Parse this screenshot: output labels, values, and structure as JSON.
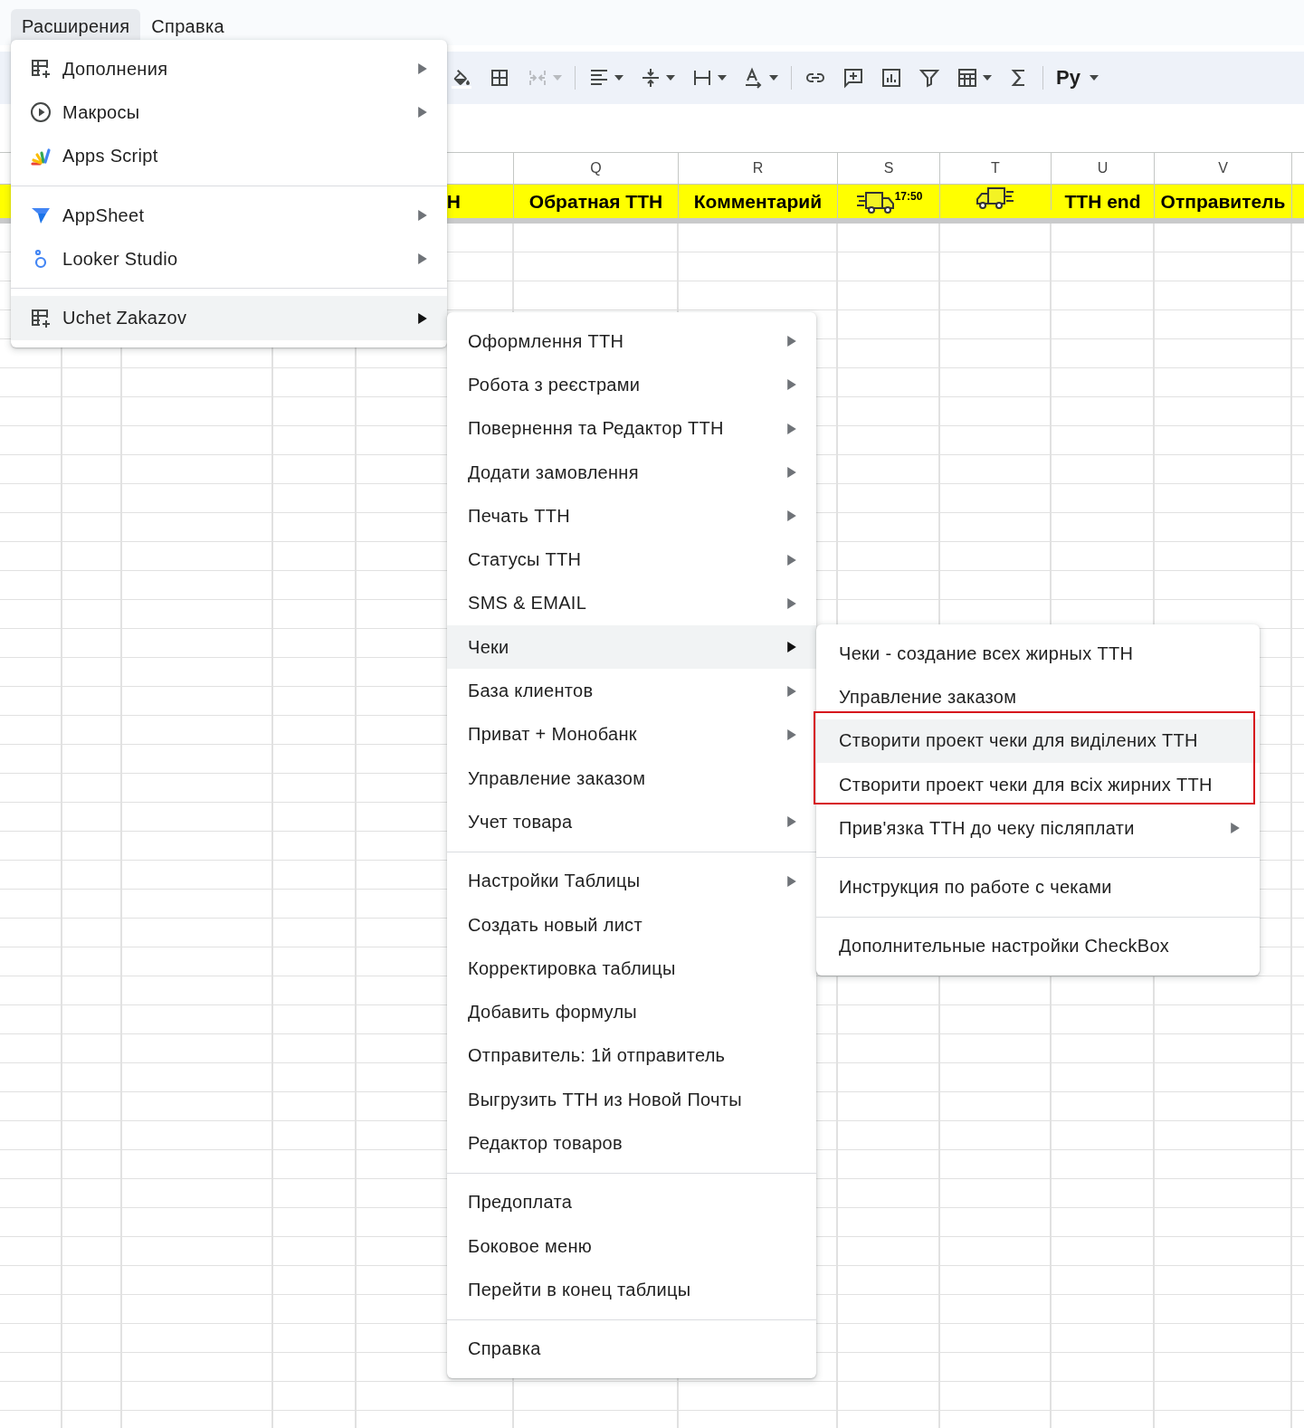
{
  "menubar": [
    {
      "label": "Расширения",
      "selected": true
    },
    {
      "label": "Справка",
      "selected": false
    }
  ],
  "toolbar": {
    "buttons": [
      {
        "disabled": false,
        "dropdown": false
      },
      {
        "disabled": false,
        "dropdown": false
      },
      {
        "disabled": true,
        "dropdown": true
      },
      {
        "disabled": false,
        "dropdown": true
      },
      {
        "disabled": false,
        "dropdown": true
      },
      {
        "disabled": false,
        "dropdown": true
      },
      {
        "disabled": false,
        "dropdown": true
      },
      {
        "disabled": false,
        "dropdown": false
      },
      {
        "disabled": false,
        "dropdown": false
      },
      {
        "disabled": false,
        "dropdown": false
      },
      {
        "disabled": false,
        "dropdown": false
      },
      {
        "disabled": false,
        "dropdown": true
      },
      {
        "disabled": false,
        "dropdown": false
      }
    ],
    "input_tools": "Ру"
  },
  "sheet": {
    "columns": [
      {
        "kind": "clipped",
        "header": "Н"
      },
      {
        "kind": "text",
        "letter": "Q",
        "header": "Обратная ТТН"
      },
      {
        "kind": "text",
        "letter": "R",
        "header": "Комментарий"
      },
      {
        "kind": "truck-time",
        "letter": "S",
        "header": "17:50"
      },
      {
        "kind": "truck",
        "letter": "T"
      },
      {
        "kind": "text",
        "letter": "U",
        "header": "ТТН end"
      },
      {
        "kind": "text",
        "letter": "V",
        "header": "Отправитель"
      }
    ]
  },
  "extensions_menu": {
    "groups": [
      {
        "items": [
          {
            "label": "Дополнения",
            "submenu": true,
            "selected": false
          },
          {
            "label": "Макросы",
            "submenu": true,
            "selected": false
          },
          {
            "label": "Apps Script",
            "submenu": false,
            "selected": false
          }
        ]
      },
      {
        "items": [
          {
            "label": "AppSheet",
            "submenu": true,
            "selected": false
          },
          {
            "label": "Looker Studio",
            "submenu": true,
            "selected": false
          }
        ]
      },
      {
        "items": [
          {
            "label": "Uchet Zakazov",
            "submenu": true,
            "selected": true
          }
        ]
      }
    ]
  },
  "uchet_menu": {
    "groups": [
      {
        "items": [
          {
            "label": "Оформлення ТТН",
            "submenu": true,
            "selected": false
          },
          {
            "label": "Робота з реєстрами",
            "submenu": true,
            "selected": false
          },
          {
            "label": "Повернення та Редактор ТТН",
            "submenu": true,
            "selected": false
          },
          {
            "label": "Додати замовлення",
            "submenu": true,
            "selected": false
          },
          {
            "label": "Печать ТТН",
            "submenu": true,
            "selected": false
          },
          {
            "label": "Статусы ТТН",
            "submenu": true,
            "selected": false
          },
          {
            "label": "SMS & EMAIL",
            "submenu": true,
            "selected": false
          },
          {
            "label": "Чеки",
            "submenu": true,
            "selected": true
          },
          {
            "label": "База клиентов",
            "submenu": true,
            "selected": false
          },
          {
            "label": "Приват + Монобанк",
            "submenu": true,
            "selected": false
          },
          {
            "label": "Управление заказом",
            "submenu": false,
            "selected": false
          },
          {
            "label": "Учет товара",
            "submenu": true,
            "selected": false
          }
        ]
      },
      {
        "items": [
          {
            "label": "Настройки Таблицы",
            "submenu": true,
            "selected": false
          },
          {
            "label": "Создать новый лист",
            "submenu": false,
            "selected": false
          },
          {
            "label": "Корректировка таблицы",
            "submenu": false,
            "selected": false
          },
          {
            "label": "Добавить формулы",
            "submenu": false,
            "selected": false
          },
          {
            "label": "Отправитель: 1й отправитель",
            "submenu": false,
            "selected": false
          },
          {
            "label": "Выгрузить ТТН из Новой Почты",
            "submenu": false,
            "selected": false
          },
          {
            "label": "Редактор товаров",
            "submenu": false,
            "selected": false
          }
        ]
      },
      {
        "items": [
          {
            "label": "Предоплата",
            "submenu": false,
            "selected": false
          },
          {
            "label": "Боковое меню",
            "submenu": false,
            "selected": false
          },
          {
            "label": "Перейти в конец таблицы",
            "submenu": false,
            "selected": false
          }
        ]
      },
      {
        "items": [
          {
            "label": "Справка",
            "submenu": false,
            "selected": false
          }
        ]
      }
    ]
  },
  "receipts_menu": {
    "groups": [
      {
        "items": [
          {
            "label": "Чеки - создание всех жирных ТТН",
            "submenu": false,
            "selected": false,
            "framed": false
          },
          {
            "label": "Управление заказом",
            "submenu": false,
            "selected": false,
            "framed": false
          },
          {
            "label": "Створити проект чеки для виділених ТТН",
            "submenu": false,
            "selected": true,
            "framed": true
          },
          {
            "label": "Створити проект чеки для всіх жирних ТТН",
            "submenu": false,
            "selected": false,
            "framed": true
          },
          {
            "label": "Прив'язка ТТН до чеку післяплати",
            "submenu": true,
            "selected": false,
            "framed": false
          }
        ]
      },
      {
        "items": [
          {
            "label": "Инструкция по работе с чеками",
            "submenu": false,
            "selected": false,
            "framed": false
          }
        ]
      },
      {
        "items": [
          {
            "label": "Дополнительные настройки CheckBox",
            "submenu": false,
            "selected": false,
            "framed": false
          }
        ]
      }
    ]
  }
}
